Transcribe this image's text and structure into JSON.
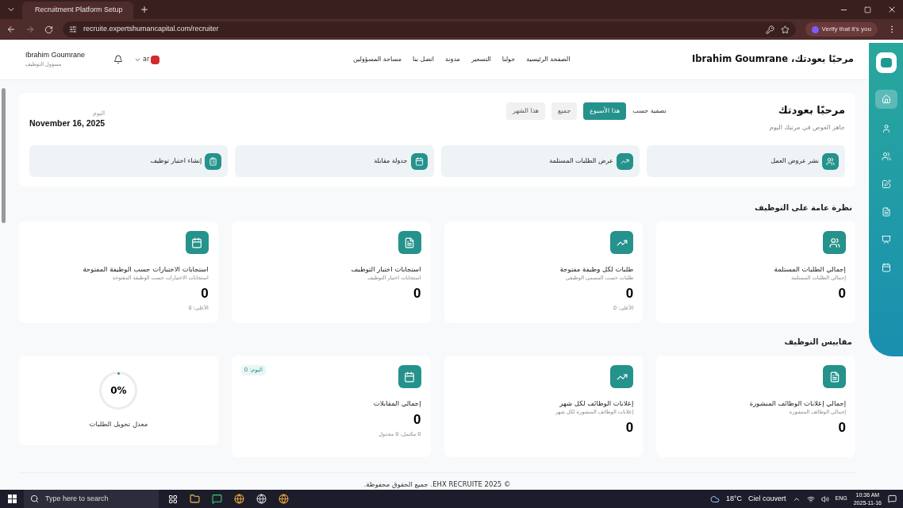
{
  "browser": {
    "tab_title": "Recruitment Platform Setup",
    "url": "recruite.expertshumancapital.com/recruiter",
    "verify_label": "Verify that it's you"
  },
  "header": {
    "greeting": "مرحبًا بعودتك، Ibrahim Goumrane",
    "nav": [
      {
        "label": "الصفحة الرئيسية"
      },
      {
        "label": "حولنا"
      },
      {
        "label": "التسعير"
      },
      {
        "label": "مدونة"
      },
      {
        "label": "اتصل بنا"
      },
      {
        "label": "مساحة المسؤولين"
      }
    ],
    "user_name": "Ibrahim Goumrane",
    "user_role": "مسؤول التوظيف",
    "language": "ar"
  },
  "sidebar": {
    "items": [
      {
        "kind": "home",
        "selected": true
      },
      {
        "kind": "user",
        "selected": false
      },
      {
        "kind": "users",
        "selected": false
      },
      {
        "kind": "edit",
        "selected": false
      },
      {
        "kind": "file",
        "selected": false
      },
      {
        "kind": "monitor",
        "selected": false
      },
      {
        "kind": "calendar",
        "selected": false
      }
    ]
  },
  "welcome": {
    "title": "مرحبًا بعودتك",
    "subtitle": "جاهز الغوص في مرتبك اليوم",
    "filter_label": "تصفية حسب",
    "filters": [
      {
        "label": "هذا الأسبوع",
        "selected": true
      },
      {
        "label": "جميع",
        "selected": false
      },
      {
        "label": "هذا الشهر",
        "selected": false
      }
    ],
    "date_label": "اليوم",
    "date": "November 16, 2025"
  },
  "quick_actions": [
    {
      "kind": "users",
      "label": "نشر عروض العمل"
    },
    {
      "kind": "trend",
      "label": "عرض الطلبات المستلمة"
    },
    {
      "kind": "calendar",
      "label": "جدولة مقابلة"
    },
    {
      "kind": "clipboard",
      "label": "إنشاء اختبار توظيف"
    }
  ],
  "overview": {
    "title": "نظرة عامة على التوظيف",
    "cards": [
      {
        "kind": "users",
        "title": "إجمالي الطلبات المستلمة",
        "subtitle": "إجمالي الطلبات المستلمة",
        "value": "0"
      },
      {
        "kind": "trend",
        "title": "طلبات لكل وظيفة مفتوحة",
        "subtitle": "طلبات حسب المسمى الوظيفي",
        "value": "0",
        "note": "الأعلى: 0"
      },
      {
        "kind": "file",
        "title": "استجابات اختبار التوظيف",
        "subtitle": "استجابات اختبار التوظيف",
        "value": "0"
      },
      {
        "kind": "calendar",
        "title": "استجابات الاختبارات حسب الوظيفة المفتوحة",
        "subtitle": "استجابات الاختبارات حسب الوظيفة المفتوحة",
        "value": "0",
        "note": "الأعلى: 0"
      }
    ]
  },
  "metrics": {
    "title": "مقاييس التوظيف",
    "cards": [
      {
        "kind": "file",
        "title": "إجمالي إعلانات الوظائف المنشورة",
        "subtitle": "إجمالي الوظائف المنشورة",
        "value": "0"
      },
      {
        "kind": "trend",
        "title": "إعلانات الوظائف لكل شهر",
        "subtitle": "إعلانات الوظائف المنشورة لكل شهر",
        "value": "0"
      },
      {
        "kind": "calendar",
        "title": "إجمالي المقابلات",
        "value": "0",
        "note": "0 مكتمل، 0 مجدول",
        "badge": "اليوم: 0"
      },
      {
        "kind": "ring",
        "title": "معدل تحويل الطلبات",
        "reading": "0%"
      }
    ]
  },
  "footer": "© 2025 EHX RECRUITE. جميع الحقوق محفوظة.",
  "taskbar": {
    "search_placeholder": "Type here to search",
    "temperature": "18°C",
    "weather": "Ciel couvert",
    "language": "ENG",
    "time": "10:36 AM",
    "date": "2025-11-16"
  }
}
